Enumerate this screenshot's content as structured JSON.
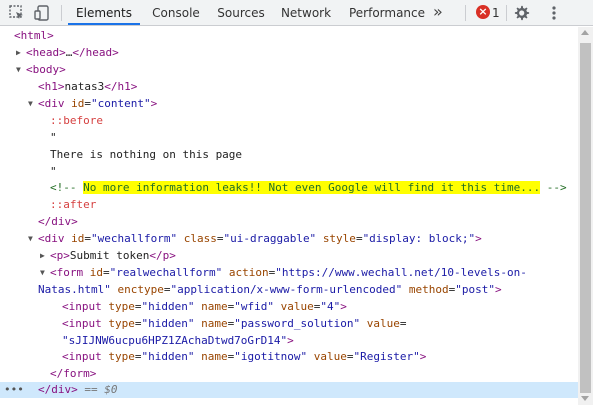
{
  "toolbar": {
    "tabs": [
      {
        "label": "Elements",
        "active": true
      },
      {
        "label": "Console"
      },
      {
        "label": "Sources"
      },
      {
        "label": "Network"
      },
      {
        "label": "Performance"
      }
    ],
    "more": "»",
    "error_icon": "×",
    "error_count": "1",
    "icons": [
      "inspect-icon",
      "device-toggle-icon",
      "error-icon",
      "gear-icon",
      "more-vert-icon"
    ],
    "accent": "#1a73e8"
  },
  "tree": {
    "html_open": "<html>",
    "head_open": "<head>",
    "head_ellipsis": "…",
    "head_close": "</head>",
    "body_open": "<body>",
    "h1_open": "<h1>",
    "h1_text": "natas3",
    "h1_close": "</h1>",
    "div_content": {
      "open": "<div",
      "attr": "id",
      "val": "\"content\"",
      "close": ">"
    },
    "before": "::before",
    "quote1": "\"",
    "text": "There is nothing on this page",
    "quote2": "\"",
    "comment_open": "<!-- ",
    "comment_text": "No more information leaks!! Not even Google will find it this time...",
    "comment_close": " -->",
    "after": "::after",
    "div_close": "</div>",
    "div_wechall": {
      "open": "<div",
      "id_attr": "id",
      "id_val": "\"wechallform\"",
      "class_attr": "class",
      "class_val": "\"ui-draggable\"",
      "style_attr": "style",
      "style_val": "\"display: block;\"",
      "close": ">"
    },
    "p_open": "<p>",
    "p_text": "Submit token",
    "p_close": "</p>",
    "form": {
      "open": "<form",
      "id_attr": "id",
      "id_val": "\"realwechallform\"",
      "action_attr": "action",
      "action_val_1": "\"https://www.wechall.net/10-levels-on-",
      "action_val_2": "Natas.html\"",
      "enctype_attr": "enctype",
      "enctype_val": "\"application/x-www-form-urlencoded\"",
      "method_attr": "method",
      "method_val": "\"post\"",
      "close": ">"
    },
    "input1": {
      "open": "<input",
      "type_attr": "type",
      "type_val": "\"hidden\"",
      "name_attr": "name",
      "name_val": "\"wfid\"",
      "value_attr": "value",
      "value_val": "\"4\"",
      "close": ">"
    },
    "input2": {
      "open": "<input",
      "type_attr": "type",
      "type_val": "\"hidden\"",
      "name_attr": "name",
      "name_val": "\"password_solution\"",
      "value_attr": "value",
      "eq": "=",
      "value_val": "\"sJIJNW6ucpu6HPZ1ZAchaDtwd7oGrD14\"",
      "close": ">"
    },
    "input3": {
      "open": "<input",
      "type_attr": "type",
      "type_val": "\"hidden\"",
      "name_attr": "name",
      "name_val": "\"igotitnow\"",
      "value_attr": "value",
      "value_val": "\"Register\"",
      "close": ">"
    },
    "form_close": "</form>",
    "div_close2": "</div>",
    "selected_suffix": "== $0",
    "dots": "•••"
  }
}
